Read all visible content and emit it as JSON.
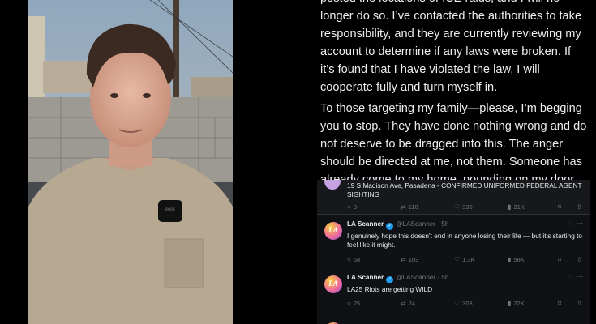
{
  "statement": {
    "paragraph1": "posted the locations of ICE raids, and I will no longer do so. I’ve contacted the authorities to take responsibility, and they are currently reviewing my account to determine if any laws were broken. If it’s found that I have violated the law, I will cooperate fully and turn myself in.",
    "paragraph2": "To those targeting my family—please, I’m begging you to stop. They have done nothing wrong and do not deserve to be dragged into this. The anger should be directed at me, not them. Someone has already come to my home, pounding on my door and demanding to"
  },
  "mic_label": "RODE",
  "feed": {
    "partial_tweet": {
      "text": "19 S Madison Ave, Pasadena - CONFIRMED UNIFORMED FEDERAL AGENT SIGHTING",
      "replies": "9",
      "reposts": "110",
      "likes": "336",
      "views": "21K"
    },
    "tweets": [
      {
        "avatar_text": "LA",
        "name": "LA Scanner",
        "handle": "@LAScanner · 5h",
        "text": "I genuinely hope this doesn't end in anyone losing their life — but it's starting to feel like it might.",
        "replies": "68",
        "reposts": "103",
        "likes": "1.3K",
        "views": "58K"
      },
      {
        "avatar_text": "LA",
        "name": "LA Scanner",
        "handle": "@LAScanner · 5h",
        "text": "LA25 Riots are getting WILD",
        "replies": "25",
        "reposts": "24",
        "likes": "303",
        "views": "22K"
      }
    ]
  },
  "icons": {
    "reply": "comment-icon",
    "repost": "repost-icon",
    "like": "heart-icon",
    "views": "views-icon",
    "bookmark": "bookmark-icon",
    "share": "share-icon"
  },
  "colors": {
    "accent": "#1d9bf0",
    "muted": "#71767b",
    "background": "#000000"
  }
}
